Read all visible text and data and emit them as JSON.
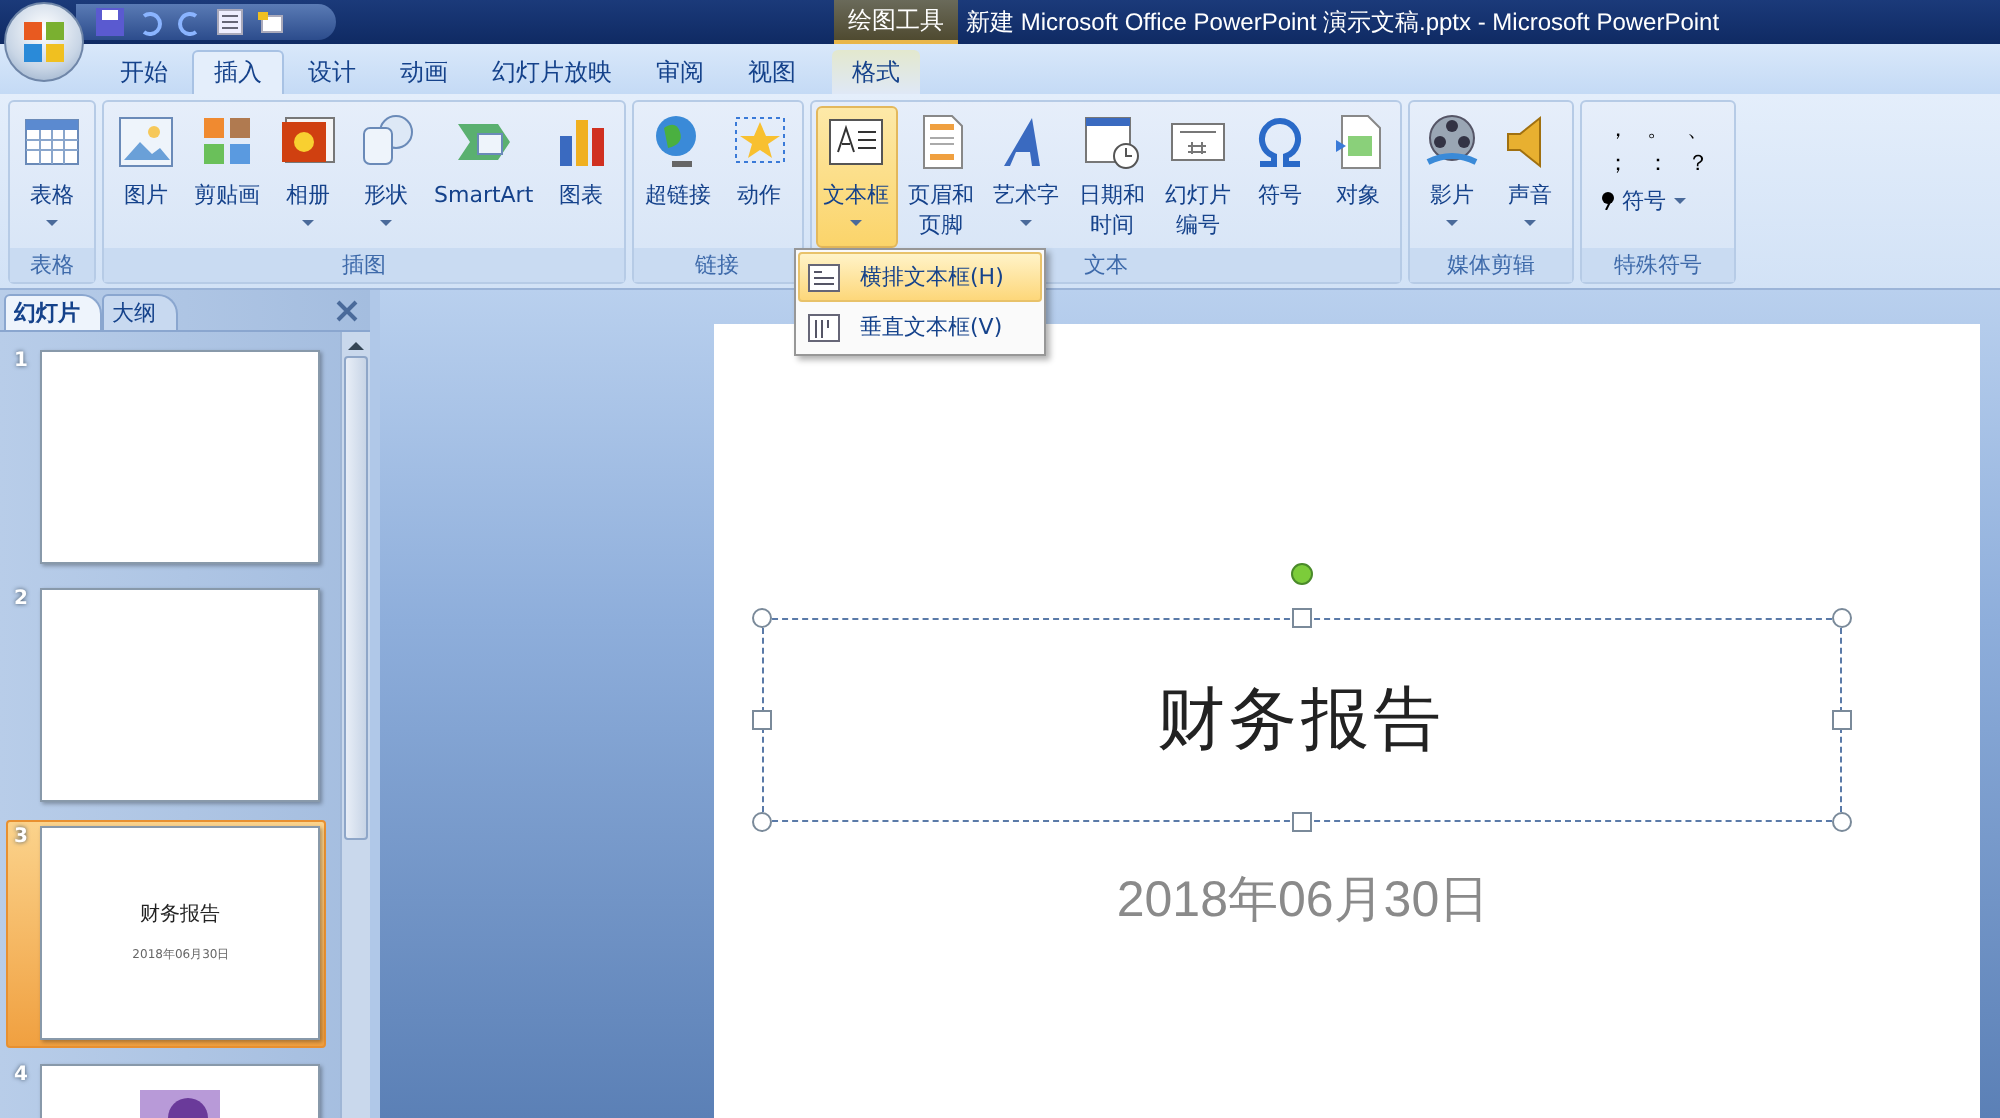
{
  "window": {
    "title": "新建 Microsoft Office PowerPoint 演示文稿.pptx - Microsoft PowerPoint",
    "contextual_label": "绘图工具"
  },
  "tabs": [
    {
      "label": "开始",
      "selected": false,
      "kind": "normal"
    },
    {
      "label": "插入",
      "selected": true,
      "kind": "normal"
    },
    {
      "label": "设计",
      "selected": false,
      "kind": "normal"
    },
    {
      "label": "动画",
      "selected": false,
      "kind": "normal"
    },
    {
      "label": "幻灯片放映",
      "selected": false,
      "kind": "normal"
    },
    {
      "label": "审阅",
      "selected": false,
      "kind": "normal"
    },
    {
      "label": "视图",
      "selected": false,
      "kind": "normal"
    },
    {
      "label": "格式",
      "selected": false,
      "kind": "contextual"
    }
  ],
  "ribbon_groups": [
    {
      "label": "表格",
      "buttons": [
        {
          "label": "表格",
          "kind": "table",
          "dropdown": true,
          "pressed": false
        }
      ]
    },
    {
      "label": "插图",
      "buttons": [
        {
          "label": "图片",
          "kind": "picture",
          "dropdown": false,
          "pressed": false
        },
        {
          "label": "剪贴画",
          "kind": "clipart",
          "dropdown": false,
          "pressed": false
        },
        {
          "label": "相册",
          "kind": "album",
          "dropdown": true,
          "pressed": false
        },
        {
          "label": "形状",
          "kind": "shapes",
          "dropdown": true,
          "pressed": false
        },
        {
          "label": "SmartArt",
          "kind": "smartart",
          "dropdown": false,
          "pressed": false
        },
        {
          "label": "图表",
          "kind": "chart",
          "dropdown": false,
          "pressed": false
        }
      ]
    },
    {
      "label": "链接",
      "buttons": [
        {
          "label": "超链接",
          "kind": "hyperlink",
          "dropdown": false,
          "pressed": false
        },
        {
          "label": "动作",
          "kind": "action",
          "dropdown": false,
          "pressed": false
        }
      ]
    },
    {
      "label": "文本",
      "buttons": [
        {
          "label": "文本框",
          "kind": "textbox",
          "dropdown": true,
          "pressed": true
        },
        {
          "label": "页眉和页脚",
          "kind": "header",
          "dropdown": false,
          "pressed": false,
          "wrap": true
        },
        {
          "label": "艺术字",
          "kind": "wordart",
          "dropdown": true,
          "pressed": false
        },
        {
          "label": "日期和时间",
          "kind": "datetime",
          "dropdown": false,
          "pressed": false,
          "wrap": true
        },
        {
          "label": "幻灯片编号",
          "kind": "slidenumber",
          "dropdown": false,
          "pressed": false,
          "wrap": true
        },
        {
          "label": "符号",
          "kind": "symbol",
          "dropdown": false,
          "pressed": false
        },
        {
          "label": "对象",
          "kind": "object",
          "dropdown": false,
          "pressed": false
        }
      ]
    },
    {
      "label": "媒体剪辑",
      "buttons": [
        {
          "label": "影片",
          "kind": "movie",
          "dropdown": true,
          "pressed": false
        },
        {
          "label": "声音",
          "kind": "sound",
          "dropdown": true,
          "pressed": false
        }
      ]
    },
    {
      "label": "特殊符号",
      "symbols": [
        "，",
        "。",
        "、",
        "；",
        "：",
        "？"
      ],
      "symbol_button": {
        "label": "符号",
        "dropdown": true
      }
    }
  ],
  "text_box_menu": [
    {
      "label": "横排文本框(H)",
      "selected": true,
      "kind": "horizontal"
    },
    {
      "label": "垂直文本框(V)",
      "selected": false,
      "kind": "vertical"
    }
  ],
  "slide_panel": {
    "tabs": [
      {
        "label": "幻灯片",
        "selected": true
      },
      {
        "label": "大纲",
        "selected": false
      }
    ],
    "slides": [
      {
        "number": "1",
        "selected": false,
        "kind": "blank"
      },
      {
        "number": "2",
        "selected": false,
        "kind": "blank"
      },
      {
        "number": "3",
        "selected": true,
        "kind": "title",
        "title": "财务报告",
        "subtitle": "2018年06月30日"
      },
      {
        "number": "4",
        "selected": false,
        "kind": "picture"
      }
    ]
  },
  "slide": {
    "title": "财务报告",
    "subtitle": "2018年06月30日",
    "title_selected": true
  }
}
